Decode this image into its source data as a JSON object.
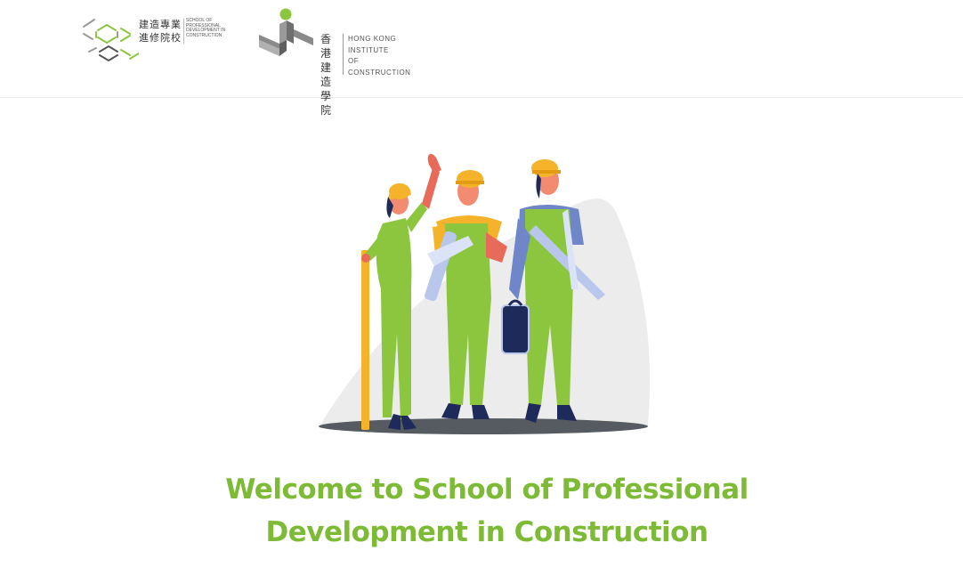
{
  "header": {
    "logo_spd": {
      "chinese_line1": "建造專業",
      "chinese_line2": "進修院校",
      "english_line1": "SCHOOL OF",
      "english_line2": "PROFESSIONAL",
      "english_line3": "DEVELOPMENT IN",
      "english_line4": "CONSTRUCTION"
    },
    "logo_hkic": {
      "chinese_line1": "香港",
      "chinese_line2": "建造",
      "chinese_line3": "學院",
      "english_line1": "HONG KONG",
      "english_line2": "INSTITUTE",
      "english_line3": "OF",
      "english_line4": "CONSTRUCTION"
    }
  },
  "main": {
    "illustration_icon": "construction-workers-illustration",
    "welcome_line1": "Welcome to School of Professional",
    "welcome_line2": "Development in Construction"
  },
  "colors": {
    "brand_green": "#7dba35",
    "overall_green": "#8cc63f",
    "helmet_yellow": "#f4b32a",
    "grey_logo": "#8a8a8a"
  }
}
